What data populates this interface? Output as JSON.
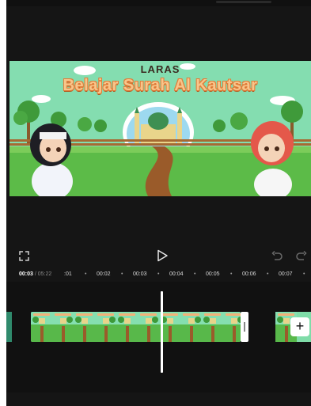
{
  "preview": {
    "thumbnail_title": "LARAS",
    "thumbnail_subtitle": "Belajar Surah Al Kautsar"
  },
  "controls": {
    "fullscreen_icon": "fullscreen-icon",
    "play_icon": "play-icon",
    "undo_icon": "undo-icon",
    "redo_icon": "redo-icon"
  },
  "ruler": {
    "current_time": "00:03",
    "separator": " / ",
    "total_duration": "05:22",
    "ticks": [
      ":01",
      "00:02",
      "00:03",
      "00:04",
      "00:05",
      "00:06",
      "00:07"
    ]
  },
  "timeline": {
    "add_label": "+"
  },
  "colors": {
    "background": "#151515",
    "accent_clip": "#7fdca8",
    "playhead": "#ffffff"
  }
}
